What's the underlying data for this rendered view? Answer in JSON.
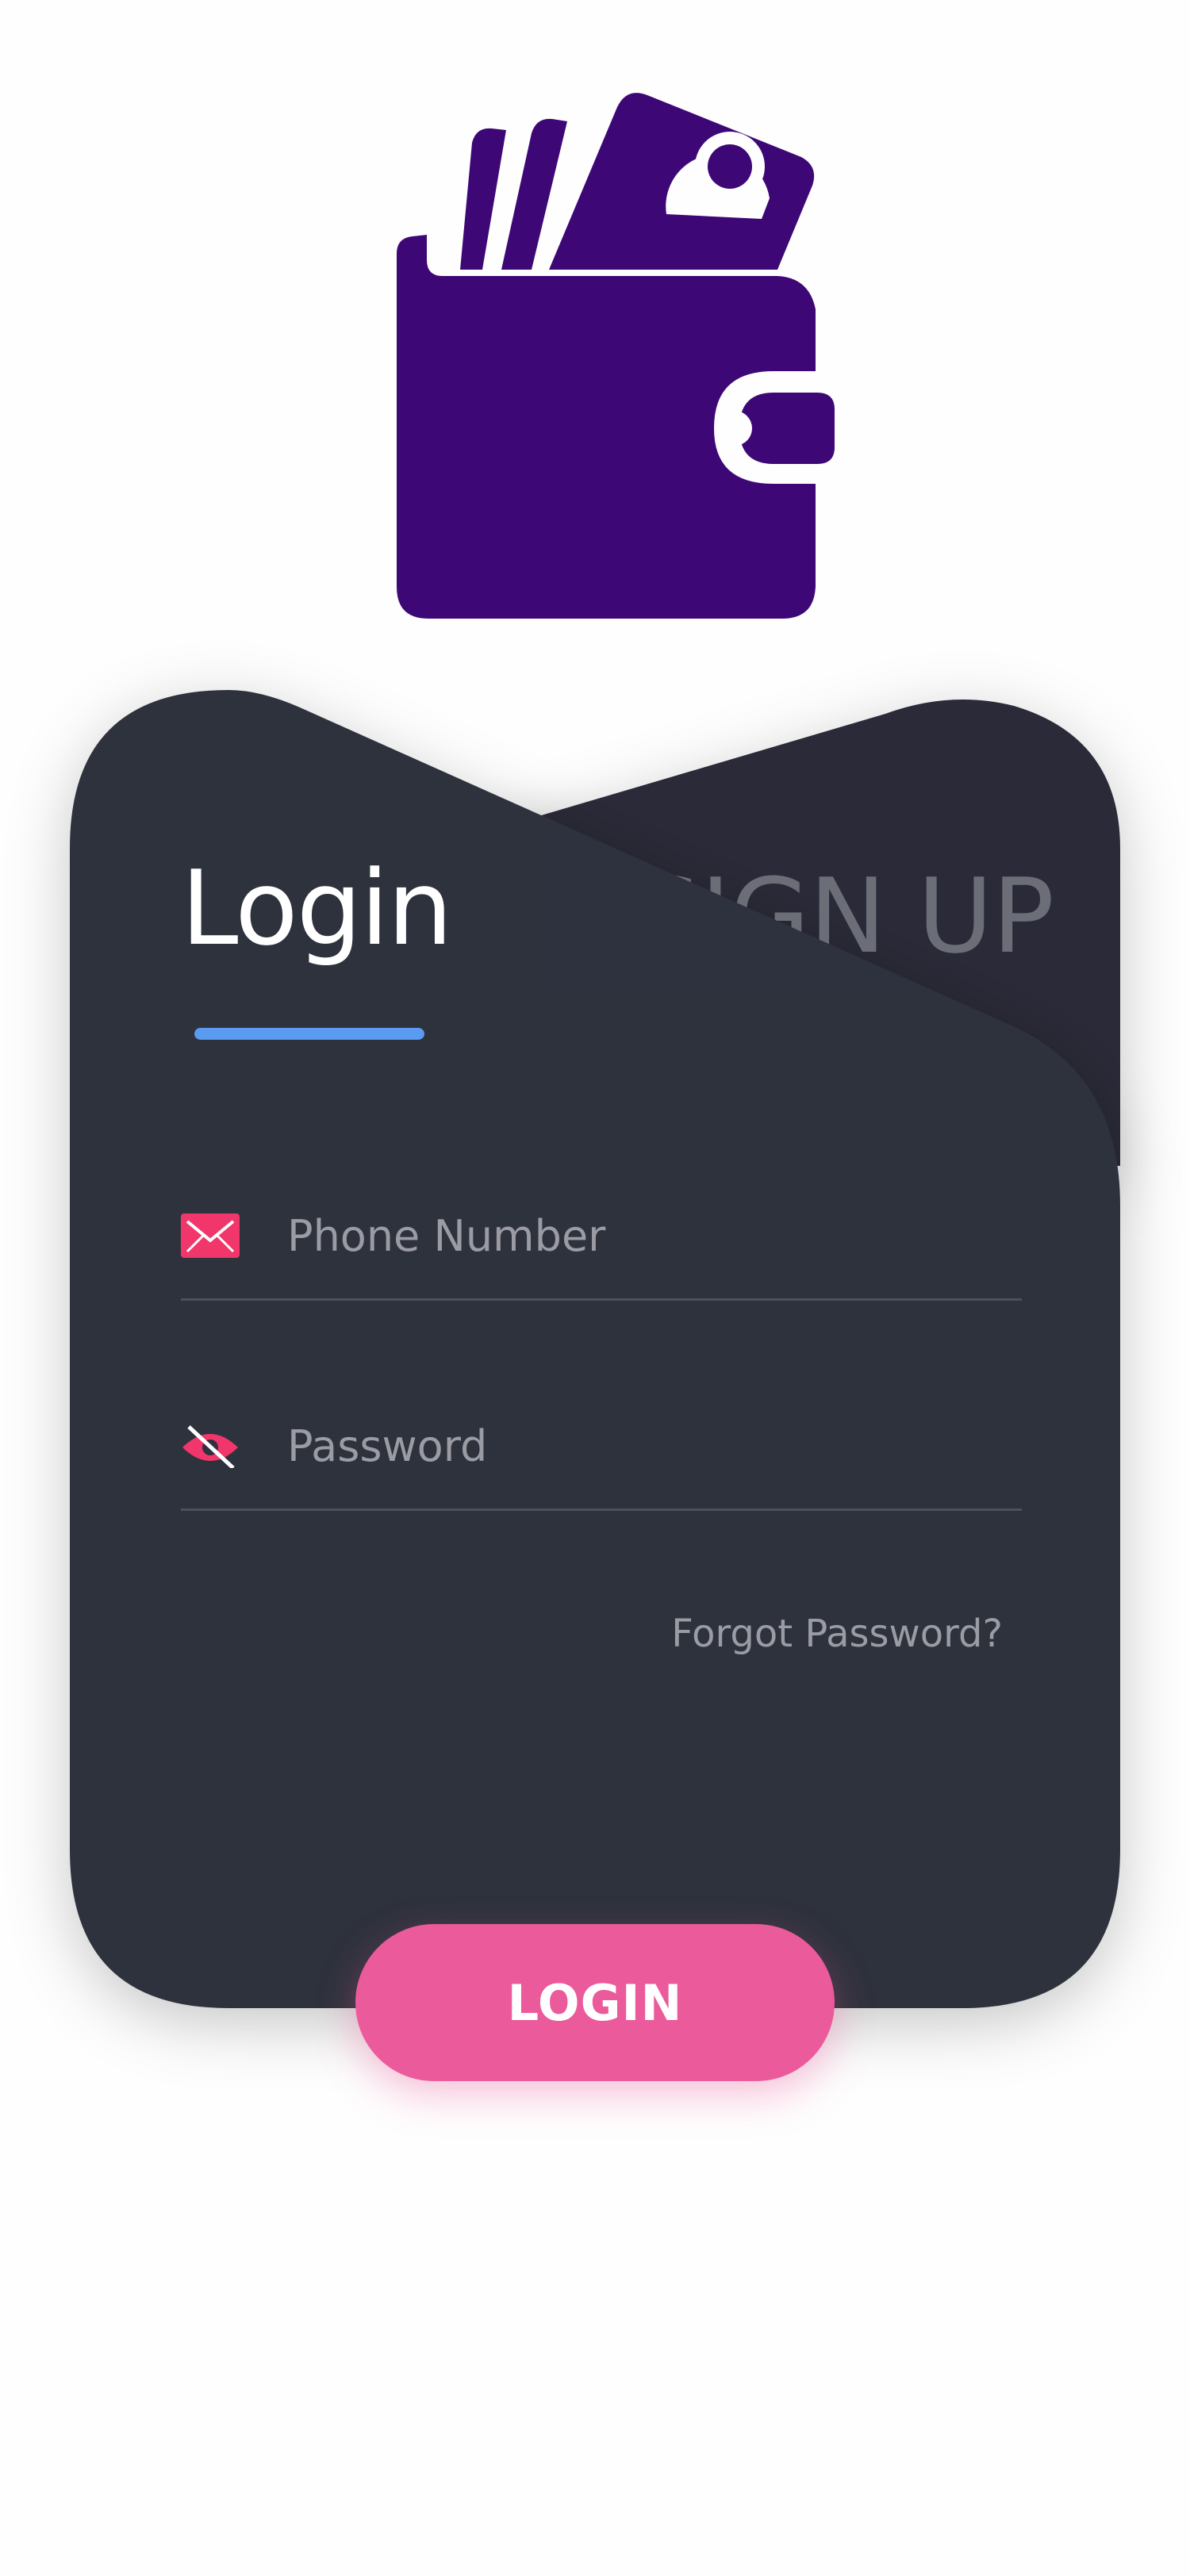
{
  "app": {
    "logo_icon": "wallet-with-cash-icon"
  },
  "colors": {
    "logo": "#3d0876",
    "card_front": "#2e313e",
    "card_back": "#292b37",
    "underline": "#5a9af0",
    "field_icon": "#f0366b",
    "login_button": "#eb5a9a",
    "muted_text": "#9a9ba3",
    "signup_text": "#6b6d77"
  },
  "tabs": {
    "login_label": "Login",
    "signup_label": "SIGN UP"
  },
  "form": {
    "phone": {
      "icon": "envelope-icon",
      "placeholder": "Phone Number",
      "value": ""
    },
    "password": {
      "icon": "eye-off-icon",
      "placeholder": "Password",
      "value": ""
    },
    "forgot_label": "Forgot Password?",
    "submit_label": "LOGIN"
  }
}
